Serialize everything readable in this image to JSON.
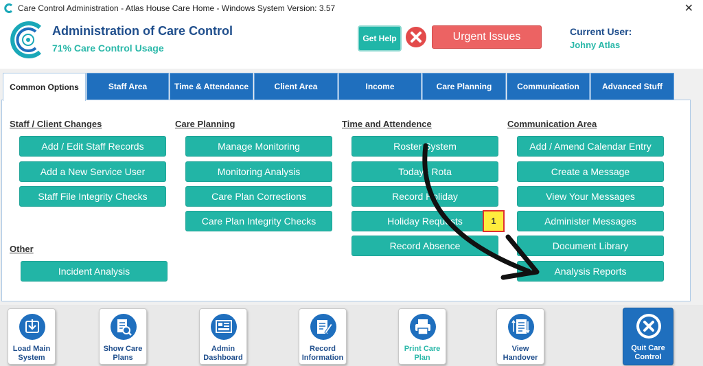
{
  "window": {
    "title": "Care Control Administration - Atlas House Care Home - Windows System Version: 3.57",
    "close_glyph": "✕"
  },
  "header": {
    "title": "Administration of Care Control",
    "subtitle": "71% Care Control Usage",
    "help_label": "Get Help",
    "urgent_label": "Urgent Issues",
    "current_user_label": "Current User:",
    "current_user_name": "Johny Atlas"
  },
  "tabs": [
    {
      "label": "Common Options"
    },
    {
      "label": "Staff Area"
    },
    {
      "label": "Time & Attendance"
    },
    {
      "label": "Client Area"
    },
    {
      "label": "Income"
    },
    {
      "label": "Care Planning"
    },
    {
      "label": "Communication"
    },
    {
      "label": "Advanced Stuff"
    }
  ],
  "sections": {
    "staff_client": {
      "heading": "Staff / Client Changes",
      "items": [
        "Add / Edit Staff Records",
        "Add a New Service User",
        "Staff File Integrity Checks"
      ]
    },
    "other": {
      "heading": "Other",
      "items": [
        "Incident Analysis"
      ]
    },
    "care_planning": {
      "heading": "Care Planning",
      "items": [
        "Manage Monitoring",
        "Monitoring Analysis",
        "Care Plan Corrections",
        "Care Plan Integrity Checks"
      ]
    },
    "time_attendance": {
      "heading": "Time and Attendence",
      "items": [
        "Roster System",
        "Todays Rota",
        "Record Holiday",
        "Holiday Requests",
        "Record Absence"
      ]
    },
    "communication": {
      "heading": "Communication Area",
      "items": [
        "Add / Amend Calendar Entry",
        "Create a Message",
        "View Your Messages",
        "Administer Messages",
        "Document Library",
        "Analysis Reports"
      ]
    }
  },
  "badge": {
    "holiday_requests_count": "1"
  },
  "toolbar": [
    {
      "label": "Load Main System",
      "icon": "load-main-system-icon"
    },
    {
      "label": "Show Care Plans",
      "icon": "search-document-icon"
    },
    {
      "label": "Admin Dashboard",
      "icon": "dashboard-icon"
    },
    {
      "label": "Record Information",
      "icon": "edit-document-icon"
    },
    {
      "label": "Print Care Plan",
      "icon": "printer-icon"
    },
    {
      "label": "View Handover",
      "icon": "handover-list-icon"
    },
    {
      "label": "Quit Care Control",
      "icon": "close-circle-icon"
    }
  ],
  "colors": {
    "teal": "#22b5a6",
    "blue": "#1f6fbe",
    "navy": "#1f4e8c",
    "urgent": "#ec6363"
  }
}
